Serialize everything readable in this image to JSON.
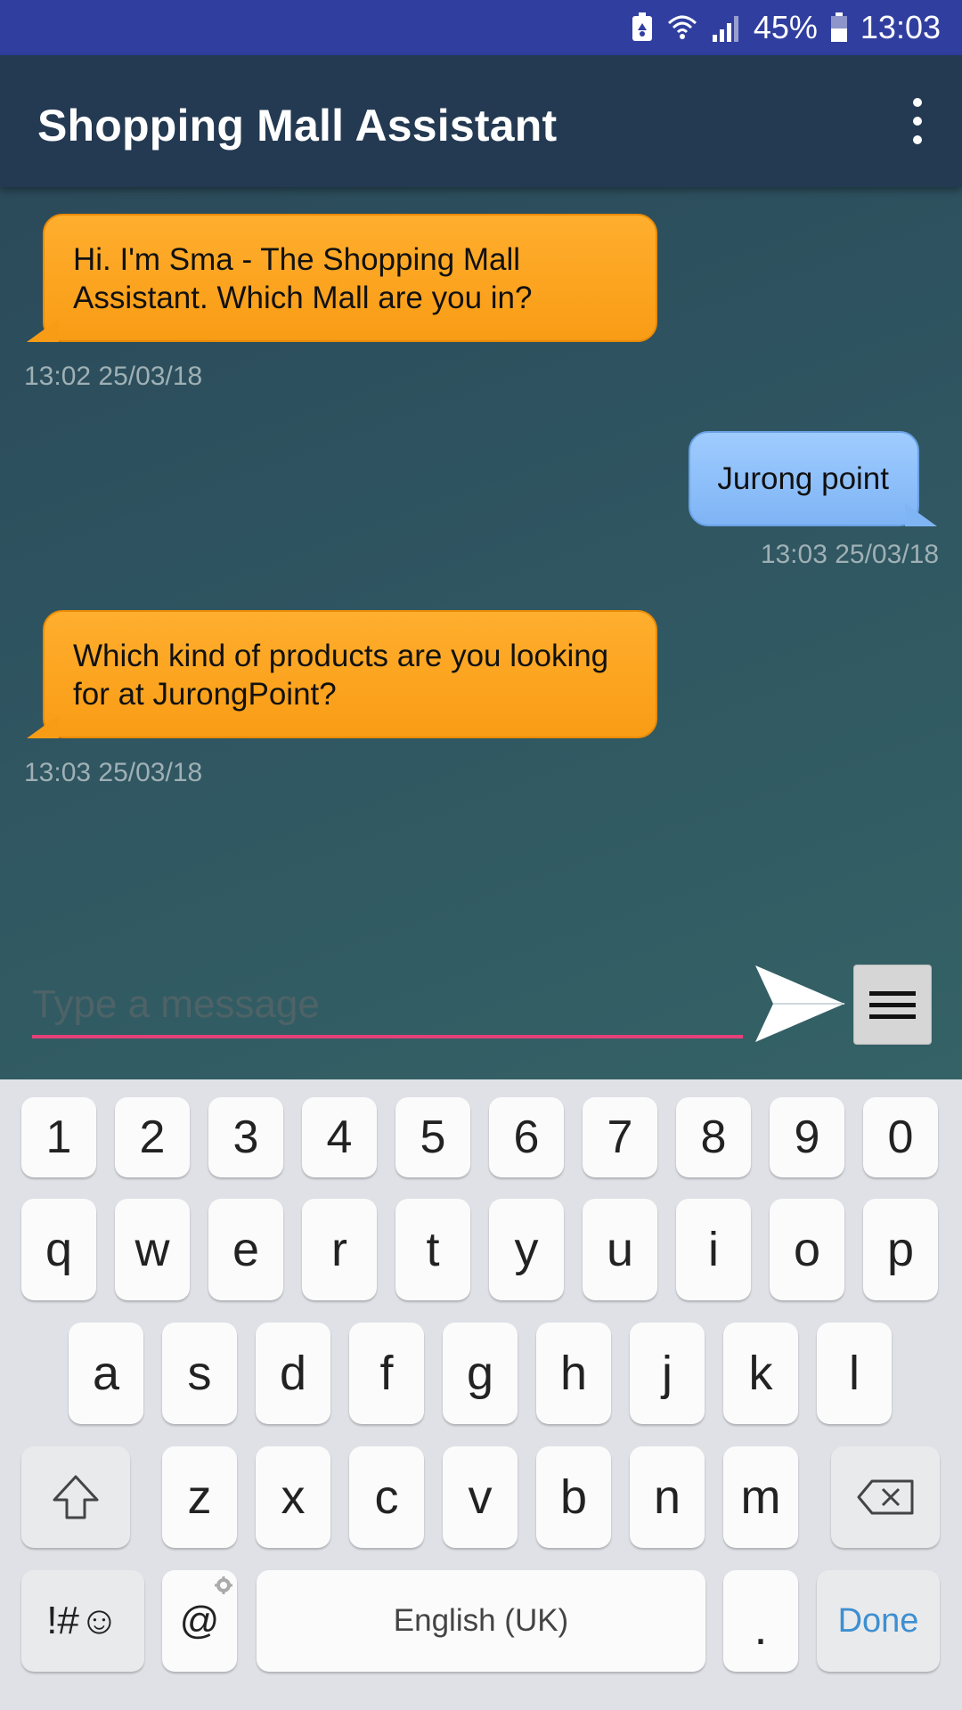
{
  "status": {
    "battery": "45%",
    "time": "13:03"
  },
  "appbar": {
    "title": "Shopping Mall Assistant"
  },
  "messages": [
    {
      "from": "bot",
      "text": "Hi. I'm Sma - The Shopping Mall Assistant. Which Mall are you in?",
      "time": "13:02 25/03/18"
    },
    {
      "from": "user",
      "text": "Jurong point",
      "time": "13:03 25/03/18"
    },
    {
      "from": "bot",
      "text": "Which kind of products are you looking for at JurongPoint?",
      "time": "13:03 25/03/18"
    }
  ],
  "composer": {
    "placeholder": "Type a message"
  },
  "keyboard": {
    "row1": [
      "1",
      "2",
      "3",
      "4",
      "5",
      "6",
      "7",
      "8",
      "9",
      "0"
    ],
    "row2": [
      "q",
      "w",
      "e",
      "r",
      "t",
      "y",
      "u",
      "i",
      "o",
      "p"
    ],
    "row3": [
      "a",
      "s",
      "d",
      "f",
      "g",
      "h",
      "j",
      "k",
      "l"
    ],
    "row4": [
      "z",
      "x",
      "c",
      "v",
      "b",
      "n",
      "m"
    ],
    "symbols_label": "!#☺",
    "at_label": "@",
    "space_label": "English (UK)",
    "period_label": ".",
    "done_label": "Done"
  },
  "colors": {
    "accent": "#e6407a",
    "bot_bubble": "#f99c15",
    "user_bubble": "#7fb4f5",
    "appbar": "#243a52",
    "statusbar": "#303f9f"
  }
}
